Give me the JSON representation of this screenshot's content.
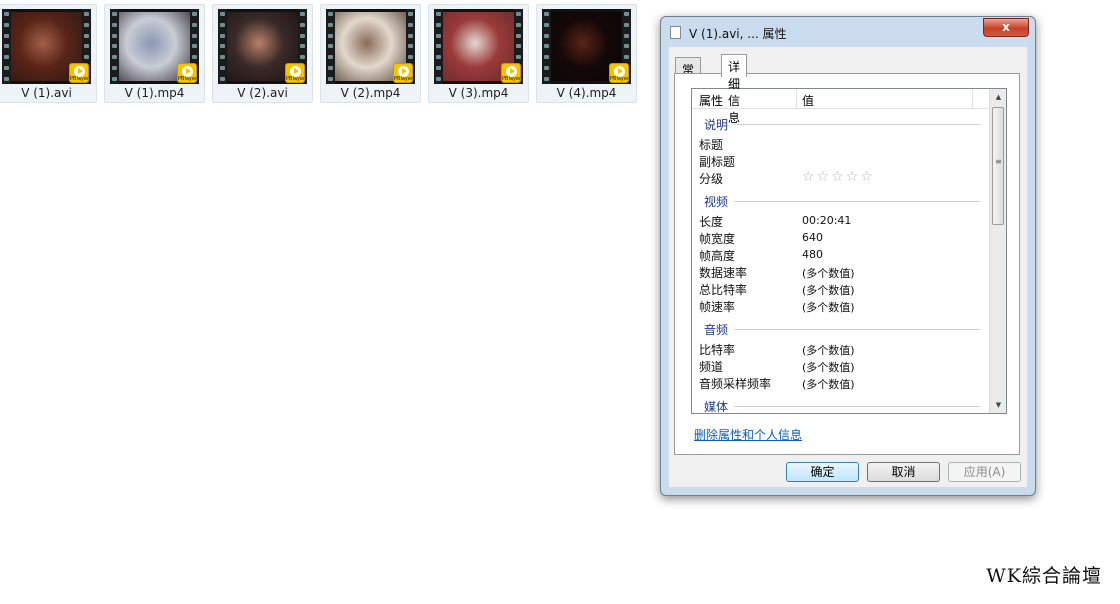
{
  "files": [
    {
      "name": "V (1).avi",
      "badge": "PBlayer",
      "frame_colors": [
        "#5a2418",
        "#a06048",
        "#2a1a14"
      ]
    },
    {
      "name": "V (1).mp4",
      "badge": "PBlayer",
      "frame_colors": [
        "#c8ccd4",
        "#8a97b4",
        "#3a3440"
      ]
    },
    {
      "name": "V (2).avi",
      "badge": "PBlayer",
      "frame_colors": [
        "#3a2a28",
        "#b78068",
        "#1a1412"
      ]
    },
    {
      "name": "V (2).mp4",
      "badge": "PBlayer",
      "frame_colors": [
        "#e2d8cc",
        "#8a6a58",
        "#5a4a3c"
      ]
    },
    {
      "name": "V (3).mp4",
      "badge": "PBlayer",
      "frame_colors": [
        "#9a3a3a",
        "#e4d8d2",
        "#6a2a2c"
      ]
    },
    {
      "name": "V (4).mp4",
      "badge": "PBlayer",
      "frame_colors": [
        "#140808",
        "#5a2418",
        "#0a0606"
      ]
    }
  ],
  "dialog": {
    "title": "V (1).avi, ... 属性",
    "close_label": "x",
    "tabs": [
      {
        "label": "常规",
        "active": false
      },
      {
        "label": "详细信息",
        "active": true
      }
    ],
    "columns": {
      "property": "属性",
      "value": "值"
    },
    "groups": {
      "description": "说明",
      "video": "视频",
      "audio": "音频",
      "media": "媒体"
    },
    "rows": {
      "title": {
        "label": "标题",
        "value": ""
      },
      "subtitle": {
        "label": "副标题",
        "value": ""
      },
      "rating": {
        "label": "分级",
        "stars": "☆☆☆☆☆",
        "rating": 0,
        "max": 5
      },
      "length": {
        "label": "长度",
        "value": "00:20:41"
      },
      "frame_width": {
        "label": "帧宽度",
        "value": "640"
      },
      "frame_height": {
        "label": "帧高度",
        "value": "480"
      },
      "data_rate": {
        "label": "数据速率",
        "value": "(多个数值)"
      },
      "total_bitrate": {
        "label": "总比特率",
        "value": "(多个数值)"
      },
      "frame_rate": {
        "label": "帧速率",
        "value": "(多个数值)"
      },
      "audio_bitrate": {
        "label": "比特率",
        "value": "(多个数值)"
      },
      "channels": {
        "label": "频道",
        "value": "(多个数值)"
      },
      "sample_rate": {
        "label": "音频采样频率",
        "value": "(多个数值)"
      }
    },
    "remove_link": "删除属性和个人信息",
    "buttons": {
      "ok": "确定",
      "cancel": "取消",
      "apply": "应用(A)"
    }
  },
  "watermark": "WK綜合論壇",
  "colors": {
    "dialog_frame": "#c9dbec",
    "link": "#0b5dbf",
    "group_heading": "#1e3a8a",
    "badge": "#f5c400"
  }
}
